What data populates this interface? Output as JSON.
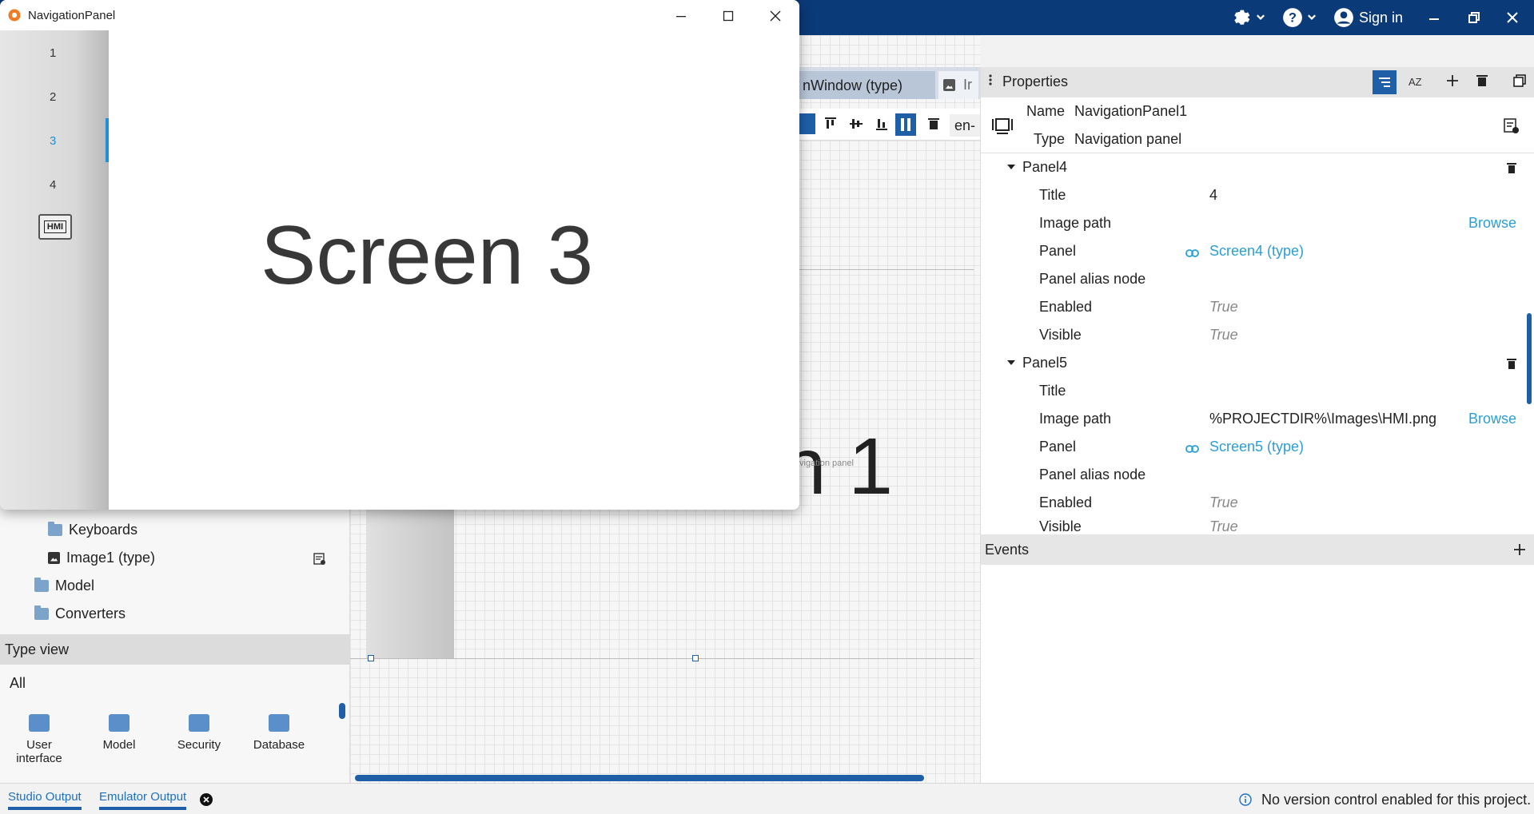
{
  "titlebar": {
    "sign_in": "Sign in"
  },
  "nav_window": {
    "title": "NavigationPanel",
    "items": [
      "1",
      "2",
      "3",
      "4"
    ],
    "selected": "3",
    "hmi_label": "HMI",
    "screen_text": "Screen 3"
  },
  "left_panel": {
    "tree": [
      {
        "label": "Keyboards",
        "icon": "folder-icon"
      },
      {
        "label": "Image1 (type)",
        "icon": "image-icon"
      },
      {
        "label": "Model",
        "icon": "model-folder-icon"
      },
      {
        "label": "Converters",
        "icon": "converters-folder-icon"
      }
    ],
    "type_view": {
      "header": "Type view",
      "filter": "All",
      "items": [
        "User interface",
        "Model",
        "Security",
        "Database"
      ]
    }
  },
  "canvas": {
    "tab_label": "nWindow (type)",
    "tab2_label": "Ir",
    "locale": "en-",
    "big_text": "n 1",
    "nav_label": "Navigation panel"
  },
  "properties": {
    "header": "Properties",
    "name_label": "Name",
    "name_value": "NavigationPanel1",
    "type_label": "Type",
    "type_value": "Navigation panel",
    "panel4": {
      "name": "Panel4",
      "title_label": "Title",
      "title_value": "4",
      "image_label": "Image path",
      "image_value": "",
      "panel_label": "Panel",
      "panel_value": "Screen4 (type)",
      "alias_label": "Panel alias node",
      "enabled_label": "Enabled",
      "enabled_value": "True",
      "visible_label": "Visible",
      "visible_value": "True"
    },
    "panel5": {
      "name": "Panel5",
      "title_label": "Title",
      "title_value": "",
      "image_label": "Image path",
      "image_value": "%PROJECTDIR%\\Images\\HMI.png",
      "panel_label": "Panel",
      "panel_value": "Screen5 (type)",
      "alias_label": "Panel alias node",
      "enabled_label": "Enabled",
      "enabled_value": "True",
      "visible_label": "Visible",
      "visible_value": "True"
    },
    "browse": "Browse",
    "events": "Events"
  },
  "status": {
    "studio_output": "Studio Output",
    "emulator_output": "Emulator Output",
    "version_msg": "No version control enabled for this project."
  },
  "colors": {
    "topbar": "#0b3a78",
    "accent": "#2a9fd6",
    "selected_nav": "#1e90d6"
  }
}
